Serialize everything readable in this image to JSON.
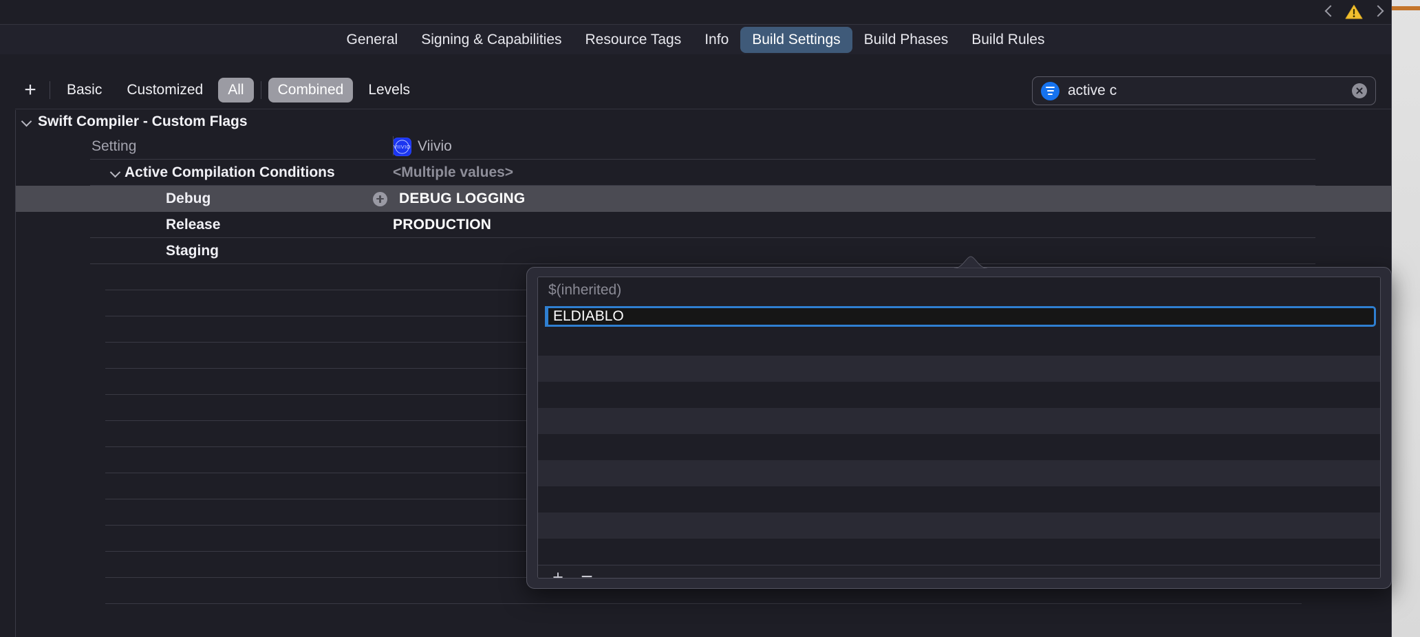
{
  "window": {
    "nav_back_icon": "chevron-left-icon",
    "nav_forward_icon": "chevron-right-icon",
    "warning_icon": "warning-triangle-icon",
    "accent_color": "#c4752a"
  },
  "tabs": [
    {
      "label": "General",
      "active": false
    },
    {
      "label": "Signing & Capabilities",
      "active": false
    },
    {
      "label": "Resource Tags",
      "active": false
    },
    {
      "label": "Info",
      "active": false
    },
    {
      "label": "Build Settings",
      "active": true
    },
    {
      "label": "Build Phases",
      "active": false
    },
    {
      "label": "Build Rules",
      "active": false
    }
  ],
  "toolbar": {
    "add_icon": "plus-icon",
    "add_label": "+",
    "filters": [
      {
        "label": "Basic",
        "on": false
      },
      {
        "label": "Customized",
        "on": false
      },
      {
        "label": "All",
        "on": true
      },
      {
        "label": "Combined",
        "on": true
      },
      {
        "label": "Levels",
        "on": false
      }
    ]
  },
  "search": {
    "icon": "filter-icon",
    "value": "active c",
    "placeholder": "Search",
    "clear_icon": "clear-circle-icon",
    "icon_color": "#1573f0"
  },
  "settings": {
    "group_title": "Swift Compiler - Custom Flags",
    "header": {
      "setting_label": "Setting",
      "target_name": "Viivio",
      "target_icon": "viivio-app-icon",
      "target_icon_text": "VIIVIO"
    },
    "rows": [
      {
        "name": "Active Compilation Conditions",
        "value": "<Multiple values>",
        "kind": "parent",
        "selected": false
      },
      {
        "name": "Debug",
        "value": "DEBUG LOGGING",
        "kind": "child",
        "selected": true,
        "badge": "plus-badge"
      },
      {
        "name": "Release",
        "value": "PRODUCTION",
        "kind": "child",
        "selected": false
      },
      {
        "name": "Staging",
        "value": "",
        "kind": "child",
        "selected": false
      }
    ]
  },
  "popover": {
    "items": [
      {
        "text": "$(inherited)",
        "type": "inherited"
      },
      {
        "text": "ELDIABLO",
        "type": "editing"
      }
    ],
    "empty_row_count": 9,
    "add_label": "+",
    "remove_label": "−",
    "add_icon": "plus-icon",
    "remove_icon": "minus-icon",
    "focus_color": "#2f7fd1"
  }
}
